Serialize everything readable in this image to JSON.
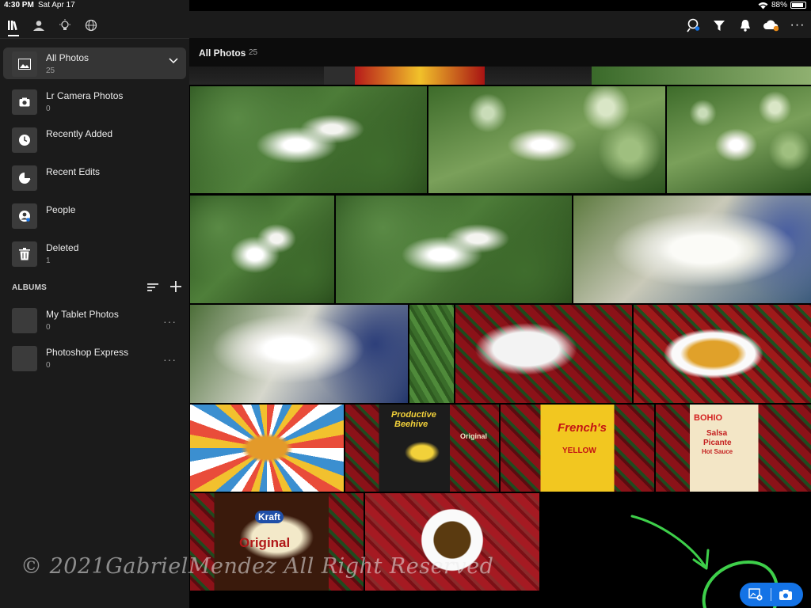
{
  "status_bar": {
    "time": "4:30 PM",
    "date": "Sat Apr 17",
    "battery_pct": "88%",
    "battery_level": 0.88
  },
  "sidebar": {
    "tabs": [
      {
        "name": "library-icon",
        "active": true
      },
      {
        "name": "people-icon",
        "active": false
      },
      {
        "name": "learn-icon",
        "active": false
      },
      {
        "name": "discover-icon",
        "active": false
      }
    ],
    "items": [
      {
        "label": "All Photos",
        "count": "25"
      },
      {
        "label": "Lr Camera Photos",
        "count": "0"
      },
      {
        "label": "Recently Added",
        "count": ""
      },
      {
        "label": "Recent Edits",
        "count": ""
      },
      {
        "label": "People",
        "count": ""
      },
      {
        "label": "Deleted",
        "count": "1"
      }
    ],
    "albums_heading": "ALBUMS",
    "albums": [
      {
        "label": "My Tablet Photos",
        "count": "0",
        "more": "···"
      },
      {
        "label": "Photoshop Express",
        "count": "0",
        "more": "···"
      }
    ]
  },
  "topbar": {
    "icons": [
      "search-people-icon",
      "filter-icon",
      "bell-icon",
      "cloud-sync-icon",
      "more-icon"
    ],
    "more": "···"
  },
  "grid": {
    "title": "All Photos",
    "count": "25"
  },
  "photo_labels": {
    "productive": "Productive",
    "beehive": "Beehive",
    "original_small": "Original",
    "frenchs": "French's",
    "classic_yellow": "YELLOW",
    "bohio": "BOHIO",
    "salsa": "Salsa",
    "picante": "Picante",
    "hot_sauce": "Hot Sauce",
    "kraft": "Kraft",
    "original": "Original"
  },
  "watermark": "© 2021GabrielMendez All Right Reserved",
  "fab": {
    "add_icon": "add-photo-icon",
    "camera_icon": "camera-icon"
  },
  "colors": {
    "accent": "#1473e6",
    "annotation": "#3ecf4a",
    "sidebar_bg": "#1b1b1b",
    "active_item": "#353535"
  }
}
